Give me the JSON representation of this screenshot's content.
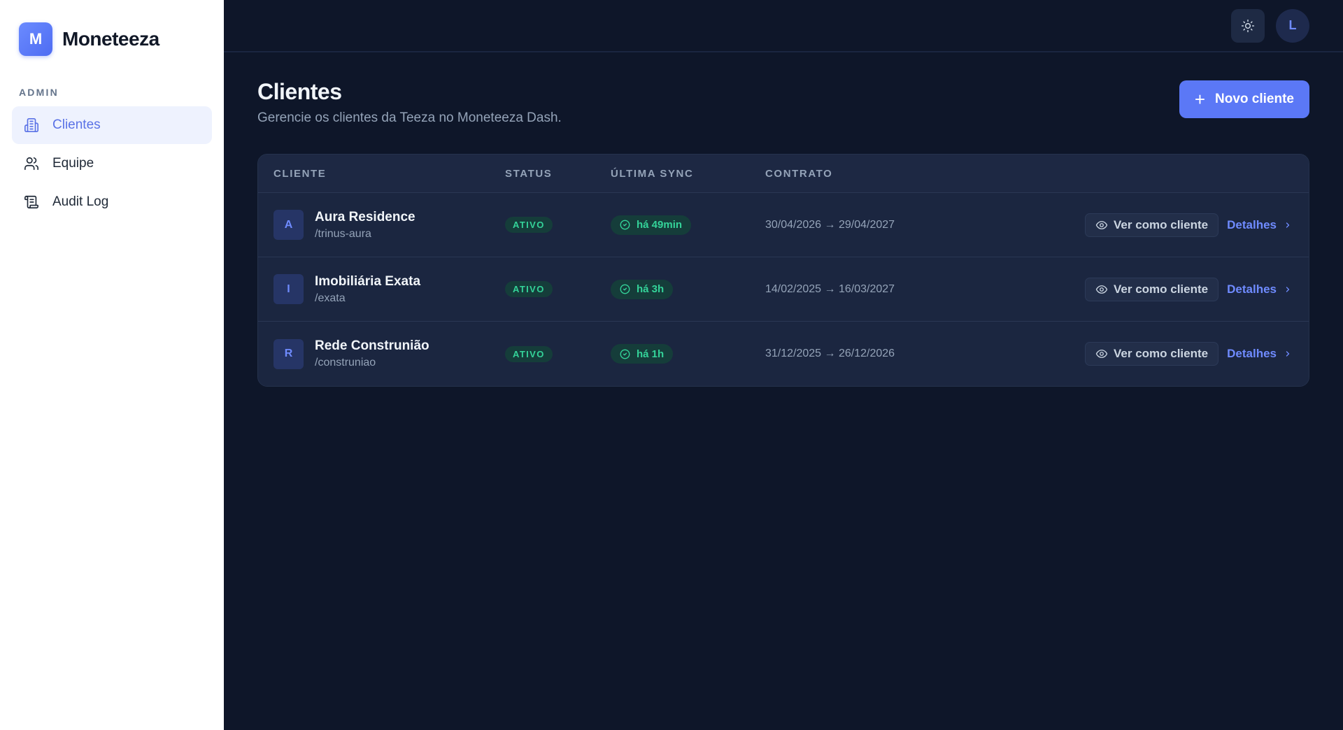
{
  "brand": {
    "logo_letter": "M",
    "name": "Moneteeza"
  },
  "sidebar": {
    "section_label": "ADMIN",
    "items": [
      {
        "label": "Clientes",
        "icon": "building-icon",
        "active": true
      },
      {
        "label": "Equipe",
        "icon": "users-icon",
        "active": false
      },
      {
        "label": "Audit Log",
        "icon": "scroll-icon",
        "active": false
      }
    ]
  },
  "topbar": {
    "theme_icon": "sun-icon",
    "avatar_initial": "L"
  },
  "page": {
    "title": "Clientes",
    "subtitle": "Gerencie os clientes da Teeza no Moneteeza Dash.",
    "new_button_label": "Novo cliente"
  },
  "table": {
    "headers": {
      "client": "CLIENTE",
      "status": "STATUS",
      "sync": "ÚLTIMA SYNC",
      "contract": "CONTRATO"
    },
    "action_view_label": "Ver como cliente",
    "action_details_label": "Detalhes",
    "rows": [
      {
        "initial": "A",
        "name": "Aura Residence",
        "slug": "/trinus-aura",
        "status": "ATIVO",
        "sync": "há 49min",
        "contract": "30/04/2026 → 29/04/2027"
      },
      {
        "initial": "I",
        "name": "Imobiliária Exata",
        "slug": "/exata",
        "status": "ATIVO",
        "sync": "há 3h",
        "contract": "14/02/2025 → 16/03/2027"
      },
      {
        "initial": "R",
        "name": "Rede Construnião",
        "slug": "/construniao",
        "status": "ATIVO",
        "sync": "há 1h",
        "contract": "31/12/2025 → 26/12/2026"
      }
    ]
  },
  "colors": {
    "accent": "#5b78f6",
    "success": "#34d399",
    "background": "#0e1629",
    "sidebar": "#ffffff"
  }
}
